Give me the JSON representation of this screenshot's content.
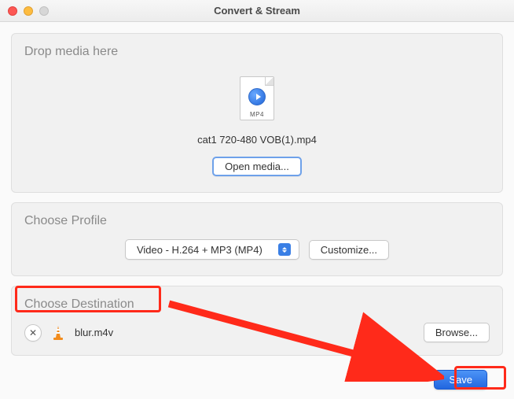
{
  "window": {
    "title": "Convert & Stream"
  },
  "dropzone": {
    "title": "Drop media here",
    "file_badge": "MP4",
    "filename": "cat1 720-480 VOB(1).mp4",
    "open_button": "Open media..."
  },
  "profile": {
    "title": "Choose Profile",
    "selected": "Video - H.264 + MP3 (MP4)",
    "customize_button": "Customize..."
  },
  "destination": {
    "title": "Choose Destination",
    "filename": "blur.m4v",
    "browse_button": "Browse..."
  },
  "footer": {
    "save_button": "Save"
  }
}
